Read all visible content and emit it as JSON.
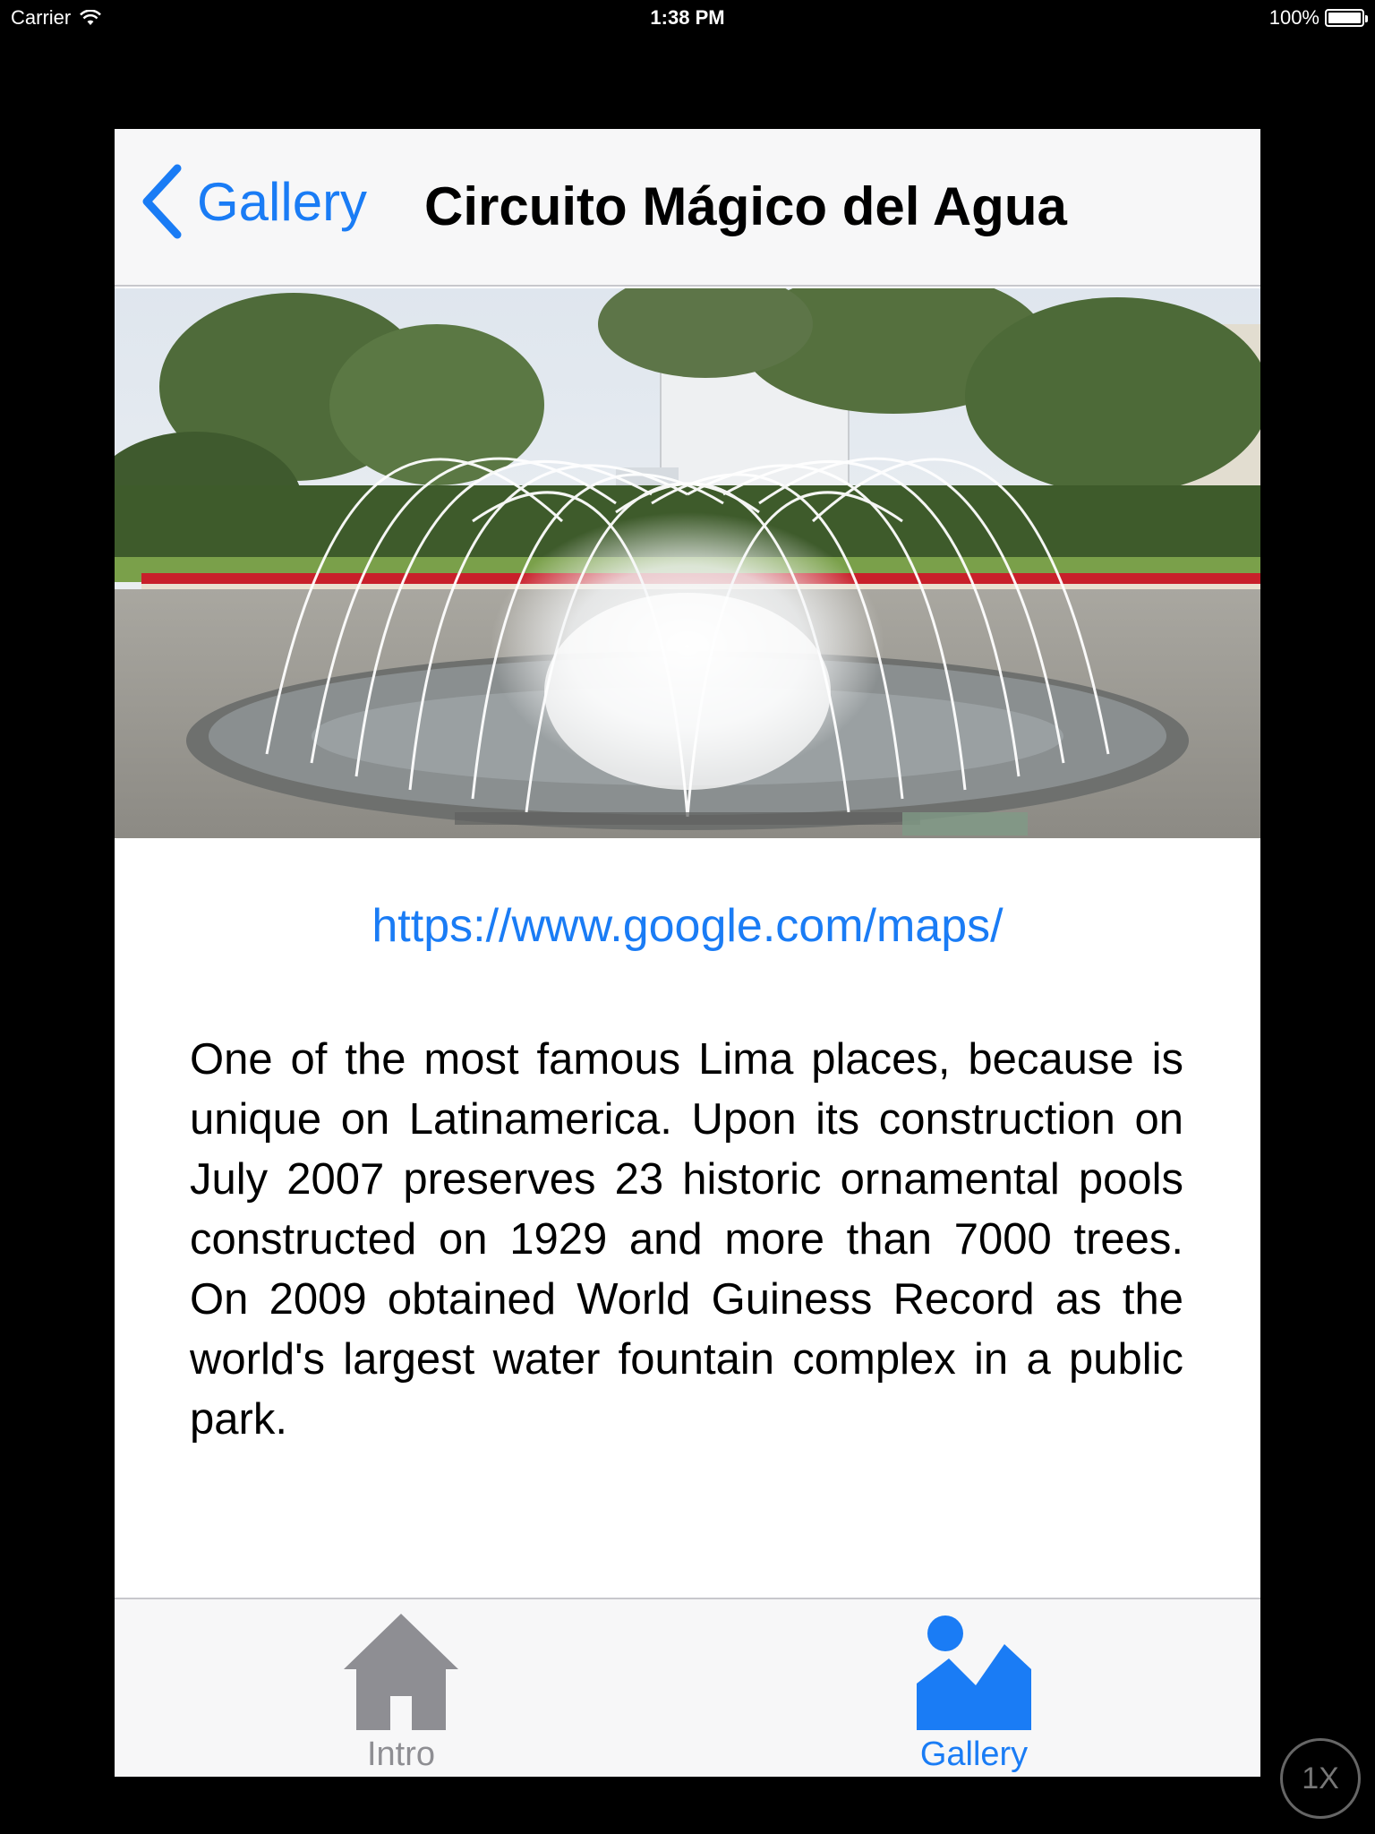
{
  "status_bar": {
    "carrier": "Carrier",
    "time": "1:38 PM",
    "battery": "100%"
  },
  "nav": {
    "back_label": "Gallery",
    "title": "Circuito Mágico del Agua"
  },
  "content": {
    "link": "https://www.google.com/maps/",
    "description": "One of the most famous Lima places, because is unique on Latinamerica. Upon its construction on July 2007 preserves 23 historic ornamental pools constructed on 1929 and more than 7000 trees. On 2009 obtained World Guiness Record as the world's largest water fountain complex in a public park."
  },
  "tab_bar": {
    "tabs": [
      {
        "label": "Intro",
        "icon": "home-icon",
        "selected": false
      },
      {
        "label": "Gallery",
        "icon": "gallery-icon",
        "selected": true
      }
    ]
  },
  "zoom_badge": "1X",
  "colors": {
    "accent": "#1a7cf5",
    "inactive": "#8e8e93",
    "bar_background": "#f7f7f8"
  }
}
